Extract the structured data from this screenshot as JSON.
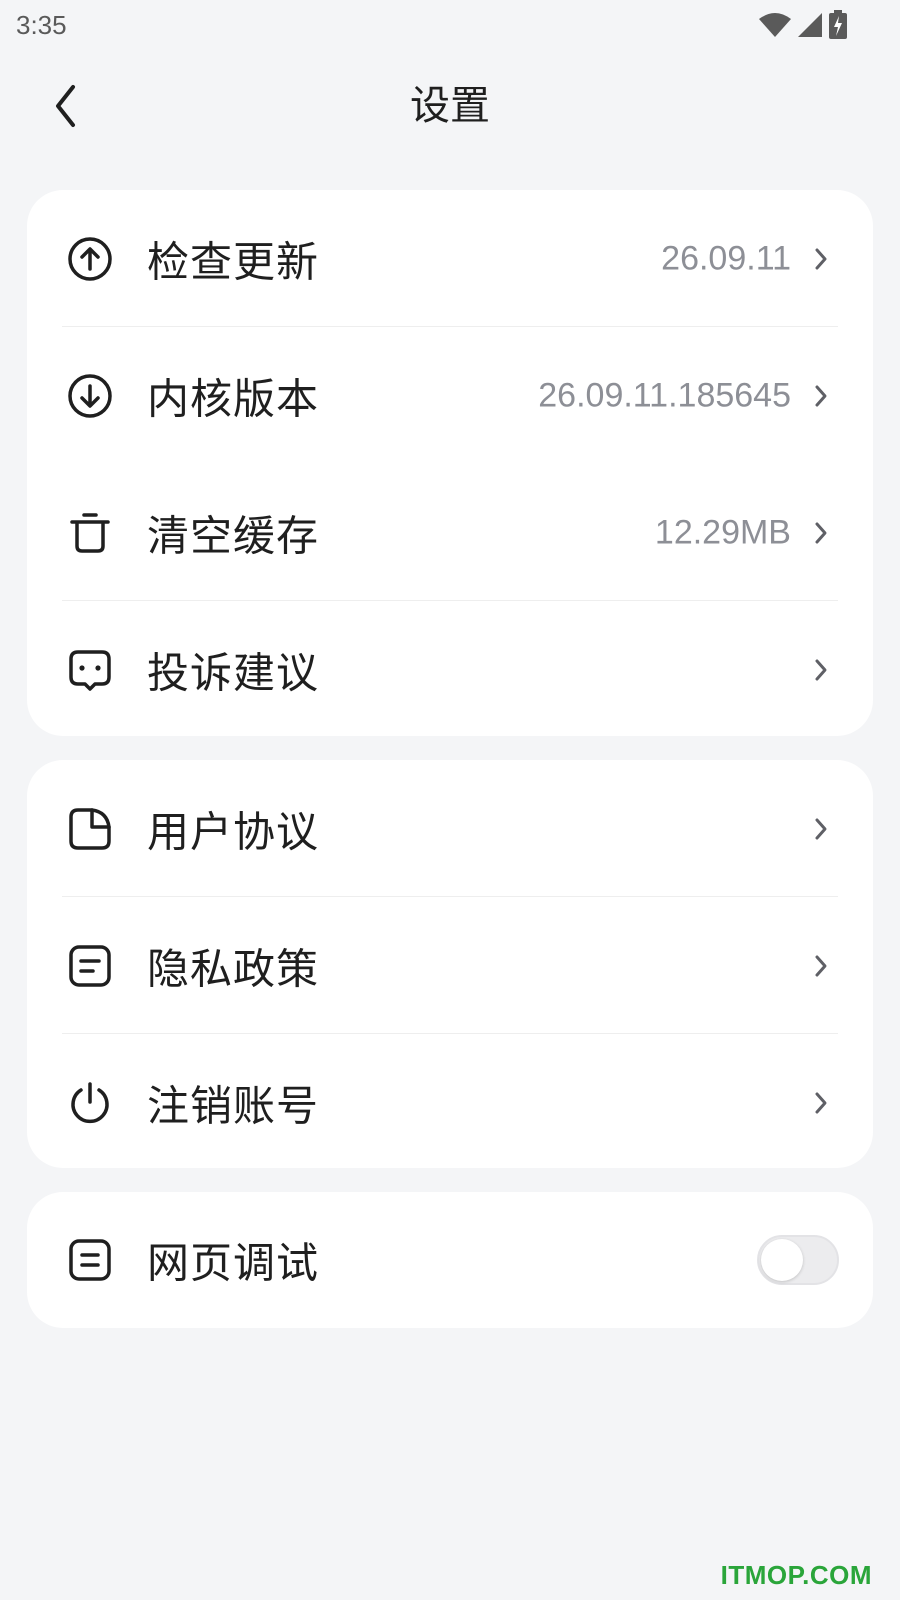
{
  "status_bar": {
    "time": "3:35",
    "icons": [
      "wifi-icon",
      "signal-icon",
      "battery-charging-icon"
    ]
  },
  "header": {
    "title": "设置",
    "back_icon": "chevron-left-icon"
  },
  "group1": [
    {
      "label": "检查更新",
      "value": "26.09.11",
      "icon": "arrow-up-circle-icon"
    },
    {
      "label": "内核版本",
      "value": "26.09.11.185645",
      "icon": "arrow-down-circle-icon"
    },
    {
      "label": "清空缓存",
      "value": "12.29MB",
      "icon": "trash-icon"
    },
    {
      "label": "投诉建议",
      "value": "",
      "icon": "chat-bubble-icon"
    }
  ],
  "group2": [
    {
      "label": "用户协议",
      "icon": "document-icon"
    },
    {
      "label": "隐私政策",
      "icon": "note-icon"
    },
    {
      "label": "注销账号",
      "icon": "power-icon"
    }
  ],
  "group3": [
    {
      "label": "网页调试",
      "icon": "web-debug-icon",
      "toggle_on": false
    }
  ],
  "colors": {
    "background": "#f4f5f7",
    "card": "#ffffff",
    "value_text": "#8d8f96",
    "watermark": "#2aa53a"
  },
  "watermark": "ITMOP.COM"
}
